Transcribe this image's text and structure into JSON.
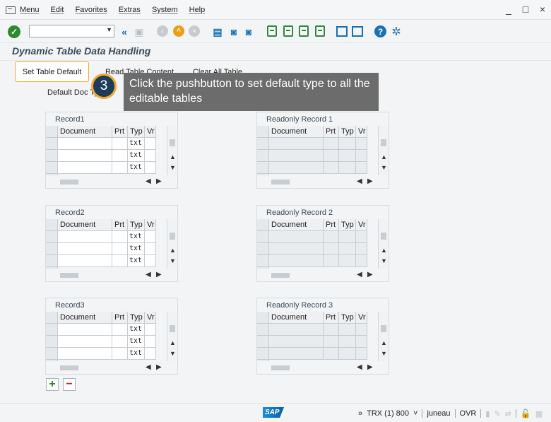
{
  "menubar": {
    "items": [
      "Menu",
      "Edit",
      "Favorites",
      "Extras",
      "System",
      "Help"
    ],
    "window_controls": [
      "_",
      "□",
      "×"
    ]
  },
  "toolbar": {
    "command_field_value": "",
    "icons": [
      "check-icon",
      "back-icon",
      "save-icon",
      "back-circle-icon",
      "up-circle-icon",
      "cancel-circle-icon",
      "print-icon",
      "find-icon",
      "find-next-icon",
      "first-page-icon",
      "prev-page-icon",
      "next-page-icon",
      "last-page-icon",
      "new-session-icon",
      "shortcut-icon",
      "help-icon",
      "settings-icon"
    ]
  },
  "page": {
    "title": "Dynamic Table Data Handling"
  },
  "app_toolbar": {
    "set_default": "Set Table Default",
    "read_content": "Read Table Content",
    "clear_all": "Clear All Table"
  },
  "tooltip": {
    "step": "3",
    "text": "Click the pushbutton to set default type to all the editable tables"
  },
  "form": {
    "default_doc_type_label": "Default Doc Ty"
  },
  "columns": [
    "Document",
    "Prt",
    "Typ",
    "Vr"
  ],
  "groups": [
    {
      "title": "Record1",
      "readonly": false,
      "rows": [
        [
          "",
          "",
          "",
          ""
        ],
        [
          "",
          "",
          "txt",
          ""
        ],
        [
          "",
          "",
          "txt",
          ""
        ],
        [
          "",
          "",
          "txt",
          ""
        ]
      ]
    },
    {
      "title": "Readonly Record 1",
      "readonly": true,
      "rows": [
        [
          "",
          "",
          "",
          ""
        ],
        [
          "",
          "",
          "",
          ""
        ],
        [
          "",
          "",
          "",
          ""
        ],
        [
          "",
          "",
          "",
          ""
        ]
      ]
    },
    {
      "title": "Record2",
      "readonly": false,
      "rows": [
        [
          "",
          "",
          "",
          ""
        ],
        [
          "",
          "",
          "txt",
          ""
        ],
        [
          "",
          "",
          "txt",
          ""
        ],
        [
          "",
          "",
          "txt",
          ""
        ]
      ]
    },
    {
      "title": "Readonly Record 2",
      "readonly": true,
      "rows": [
        [
          "",
          "",
          "",
          ""
        ],
        [
          "",
          "",
          "",
          ""
        ],
        [
          "",
          "",
          "",
          ""
        ],
        [
          "",
          "",
          "",
          ""
        ]
      ]
    },
    {
      "title": "Record3",
      "readonly": false,
      "rows": [
        [
          "",
          "",
          "",
          ""
        ],
        [
          "",
          "",
          "txt",
          ""
        ],
        [
          "",
          "",
          "txt",
          ""
        ],
        [
          "",
          "",
          "txt",
          ""
        ]
      ]
    },
    {
      "title": "Readonly Record 3",
      "readonly": true,
      "rows": [
        [
          "",
          "",
          "",
          ""
        ],
        [
          "",
          "",
          "",
          ""
        ],
        [
          "",
          "",
          "",
          ""
        ],
        [
          "",
          "",
          "",
          ""
        ]
      ]
    }
  ],
  "row_buttons": {
    "add": "+",
    "remove": "−"
  },
  "statusbar": {
    "logo": "SAP",
    "expand": "»",
    "system": "TRX (1) 800",
    "system_dropdown": "˅",
    "server": "juneau",
    "mode": "OVR"
  }
}
